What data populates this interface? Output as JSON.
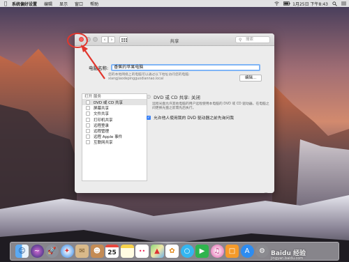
{
  "menubar": {
    "items": [
      "系统偏好设置",
      "编辑",
      "显示",
      "窗口",
      "帮助"
    ],
    "clock": "1月25日 下午8:43"
  },
  "window": {
    "title": "共享",
    "search_placeholder": "搜索",
    "computer_name_label": "电脑名称:",
    "computer_name_value": "香蕉的苹果电脑",
    "hint_line1": "您的本地网络上的电脑可以通过以下地址访问您的电脑:",
    "hint_line2": "xiangjiaodepingguodiannao.local",
    "edit_button": "编辑...",
    "services_header_on": "打开",
    "services_header_service": "服务",
    "services": [
      "DVD 或 CD 共享",
      "屏幕共享",
      "文件共享",
      "打印机共享",
      "远程登录",
      "远程管理",
      "远程 Apple 事件",
      "互联网共享"
    ],
    "status": "DVD 或 CD 共享: 关闭",
    "description": "远程光盘允许其他电脑的用户远程使用本电脑的 DVD 或 CD 驱动器。在电脑之间更换光盘之前需先后执行。",
    "ask_permission": "允许他人使用我的 DVD 驱动器之前先询问我",
    "help": "?"
  },
  "dock": {
    "icons": [
      "finder-icon",
      "siri-icon",
      "launchpad-icon",
      "safari-icon",
      "mail-icon",
      "contacts-icon",
      "calendar-icon",
      "notes-icon",
      "reminders-icon",
      "maps-icon",
      "photos-icon",
      "messages-icon",
      "facetime-icon",
      "itunes-icon",
      "ibooks-icon",
      "appstore-icon",
      "preferences-icon"
    ],
    "calendar_day": "25"
  },
  "watermark": {
    "text": "Baidu 经验",
    "sub": "jingyan.baidu.com"
  },
  "colors": {
    "accent": "#3b82f6",
    "annotation": "#e1362d",
    "close": "#fc605c"
  }
}
